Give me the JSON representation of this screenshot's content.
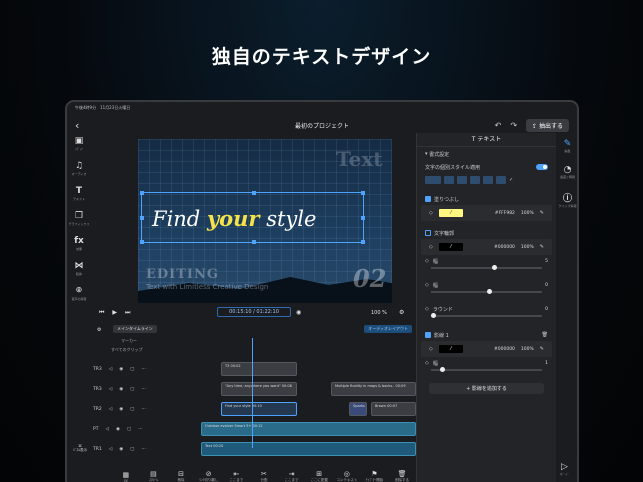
{
  "headline": "独自のテキストデザイン",
  "status_bar": "午後4時9分　11月23日火曜日",
  "topbar": {
    "title": "最初のプロジェクト",
    "export_label": "抽出する"
  },
  "left_tools": [
    {
      "icon": "folder-icon",
      "glyph": "▣",
      "label": "ﾒﾃﾞｨｱ"
    },
    {
      "icon": "music-icon",
      "glyph": "♫",
      "label": "オーディオ"
    },
    {
      "icon": "text-icon",
      "glyph": "T",
      "label": "テキスト"
    },
    {
      "icon": "graphics-icon",
      "glyph": "❐",
      "label": "グラフィックス"
    },
    {
      "icon": "effects-icon",
      "glyph": "fx",
      "label": "効果"
    },
    {
      "icon": "transition-icon",
      "glyph": "⋈",
      "label": "転換"
    },
    {
      "icon": "mic-icon",
      "glyph": "⌾",
      "label": "音声の録音"
    }
  ],
  "preview": {
    "bg_text": "Text",
    "main_text_pre": "Find",
    "main_text_highlight": "your",
    "main_text_post": "style",
    "editing": "EDITING",
    "tagline": "Text with Limitless Creative Design",
    "big_number": "02"
  },
  "controls": {
    "timecode": "00:15:10 / 01:22:10",
    "zoom": "100 %"
  },
  "timeline": {
    "main_label": "メインタイムライン",
    "auto_label": "オーディオレイアウト",
    "marker_label": "マーカー",
    "all_clips_label": "すべてのクリップ",
    "tracks": [
      {
        "name": "TR3",
        "clips": [
          {
            "text": "T3",
            "dur": "00:02"
          }
        ]
      },
      {
        "name": "TR3",
        "clips": [
          {
            "text": "\"Any time, anywhere you want\"",
            "dur": "00:08"
          },
          {
            "text": "Multiple fluidity in maps & backs..",
            "dur": "00:09"
          }
        ]
      },
      {
        "name": "TR2",
        "clips": [
          {
            "text": "Find your style",
            "dur": "00:10"
          },
          {
            "text": "Sparks",
            "dur": ""
          },
          {
            "text": "Brown",
            "dur": "00:07"
          }
        ]
      },
      {
        "name": "PT",
        "clips": [
          {
            "text": "Outdoor evolver Smart 5+",
            "dur": "00:12"
          }
        ]
      },
      {
        "name": "TR1",
        "clips": [
          {
            "text": "Text",
            "dur": "00:20"
          }
        ]
      }
    ]
  },
  "bottom_tools": [
    "SE",
    "ｽｸﾛｰﾙ",
    "削除",
    "ﾘﾝｸ切り離し",
    "ここまで",
    "分割",
    "ここまで",
    "ここに配置",
    "コンテキスト",
    "ﾁｬﾌﾟﾀｰ開始",
    "削除する"
  ],
  "side_label": "ﾊﾞﾈﾙ表示",
  "panel": {
    "title": "テキスト",
    "section": "書式設定",
    "presets_label": "文字の個別スタイル適用",
    "fill_label": "塗りつぶし",
    "fill_hex": "#FFF982",
    "fill_opacity": "100%",
    "outline_label": "文字輪郭",
    "outline_hex": "#000000",
    "outline_opacity": "100%",
    "width_label": "幅",
    "width_value": "5",
    "width_value2": "0",
    "radius_label": "ラウンド",
    "radius_value": "0",
    "shadow_label": "影線 1",
    "shadow_hex": "#000000",
    "shadow_opacity": "100%",
    "shadow_width_value": "1",
    "add_button": "+ 影線を追加する",
    "colors": {
      "fill": "#fff982",
      "outline": "#000000",
      "accent": "#4ea3ff"
    }
  },
  "right_tools": [
    {
      "icon": "pen-icon",
      "label": "編集"
    },
    {
      "icon": "speed-icon",
      "label": "速度と時間"
    },
    {
      "icon": "info-icon",
      "label": "クリップ情報"
    },
    {
      "icon": "play-icon",
      "label": "ｽﾋﾟｰﾄﾞ"
    }
  ]
}
